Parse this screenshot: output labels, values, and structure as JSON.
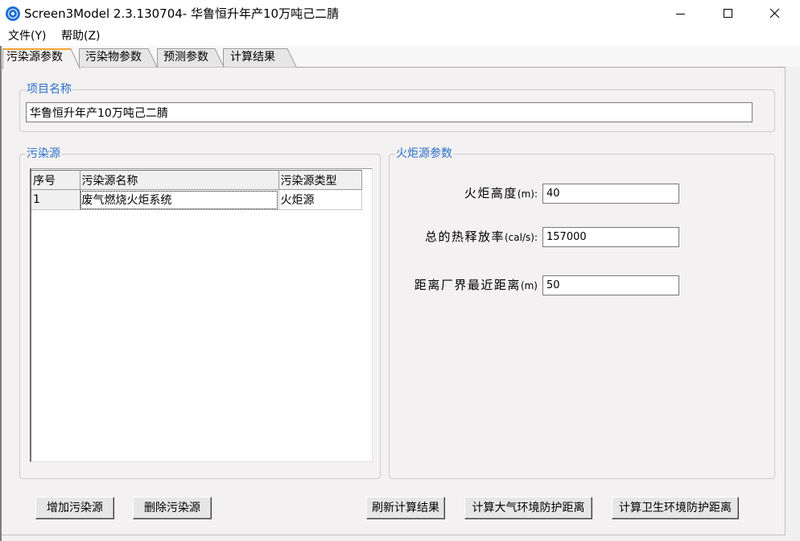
{
  "window": {
    "title": "Screen3Model 2.3.130704- 华鲁恒升年产10万吨己二腈",
    "icons": {
      "app": "globe-icon",
      "minimize": "minimize-icon",
      "maximize": "maximize-icon",
      "close": "close-icon"
    }
  },
  "menu": {
    "items": [
      {
        "label": "文件(Y)"
      },
      {
        "label": "帮助(Z)"
      }
    ]
  },
  "tabs": {
    "active_index": 0,
    "items": [
      {
        "label": "污染源参数"
      },
      {
        "label": "污染物参数"
      },
      {
        "label": "预测参数"
      },
      {
        "label": "计算结果"
      }
    ]
  },
  "project": {
    "group_label": "项目名称",
    "name": "华鲁恒升年产10万吨己二腈"
  },
  "sources": {
    "group_label": "污染源",
    "columns": [
      "序号",
      "污染源名称",
      "污染源类型"
    ],
    "rows": [
      [
        "1",
        "废气燃烧火炬系统",
        "火炬源"
      ]
    ]
  },
  "flare": {
    "group_label": "火炬源参数",
    "fields": [
      {
        "label": "火炬高度",
        "unit": "(m):",
        "value": "40"
      },
      {
        "label": "总的热释放率",
        "unit": "(cal/s):",
        "value": "157000"
      },
      {
        "label": "距离厂界最近距离",
        "unit": "(m)",
        "value": "50"
      }
    ]
  },
  "buttons": {
    "add_source": "增加污染源",
    "delete_source": "删除污染源",
    "refresh_results": "刷新计算结果",
    "calc_atmospheric_distance": "计算大气环境防护距离",
    "calc_sanitary_distance": "计算卫生环境防护距离"
  },
  "colors": {
    "group_label": "#2b6fca",
    "panel_bg": "#f3f1f1",
    "active_tab_accent": "#f0a830",
    "app_icon": "#1f6fd1"
  }
}
